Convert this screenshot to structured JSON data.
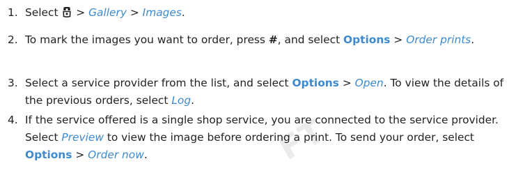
{
  "watermark": "FT",
  "steps": [
    {
      "num": "1.",
      "select": "Select",
      "sep1": ">",
      "gallery": "Gallery",
      "sep2": ">",
      "images": "Images",
      "end": "."
    },
    {
      "num": "2.",
      "t1": "To mark the images you want to order, press",
      "key": "#",
      "t2": ", and select",
      "options": "Options",
      "sep": ">",
      "order_prints": "Order prints",
      "end": "."
    },
    {
      "num": "3.",
      "t1": "Select a service provider from the list, and select",
      "options": "Options",
      "sep": ">",
      "open": "Open",
      "t2": ". To view the details of the previous orders, select",
      "log": "Log",
      "end": "."
    },
    {
      "num": "4.",
      "t1": "If the service offered is a single shop service, you are connected to the service provider. Select",
      "preview": "Preview",
      "t2": "to view the image before ordering a print. To send your order, select",
      "options": "Options",
      "sep": ">",
      "order_now": "Order now",
      "end": "."
    }
  ]
}
